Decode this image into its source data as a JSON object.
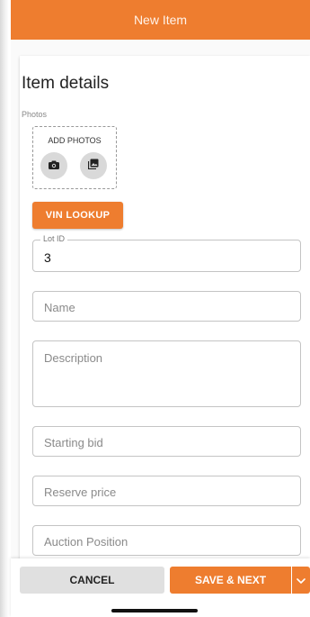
{
  "appbar": {
    "title": "New Item"
  },
  "section": {
    "title": "Item details"
  },
  "photos": {
    "label": "Photos",
    "add_label": "ADD PHOTOS",
    "camera_icon": "camera-icon",
    "gallery_icon": "gallery-icon"
  },
  "vin": {
    "label": "VIN LOOKUP"
  },
  "fields": {
    "lot_id": {
      "label": "Lot ID",
      "value": "3"
    },
    "name": {
      "placeholder": "Name"
    },
    "description": {
      "placeholder": "Description"
    },
    "starting_bid": {
      "placeholder": "Starting bid"
    },
    "reserve_price": {
      "placeholder": "Reserve price"
    },
    "auction_position": {
      "placeholder": "Auction Position"
    }
  },
  "bottom": {
    "cancel_label": "CANCEL",
    "save_label": "SAVE & NEXT",
    "split_icon": "chevron-down-icon"
  },
  "colors": {
    "accent": "#ee7d2f",
    "cancel_bg": "#e0e0e0"
  }
}
